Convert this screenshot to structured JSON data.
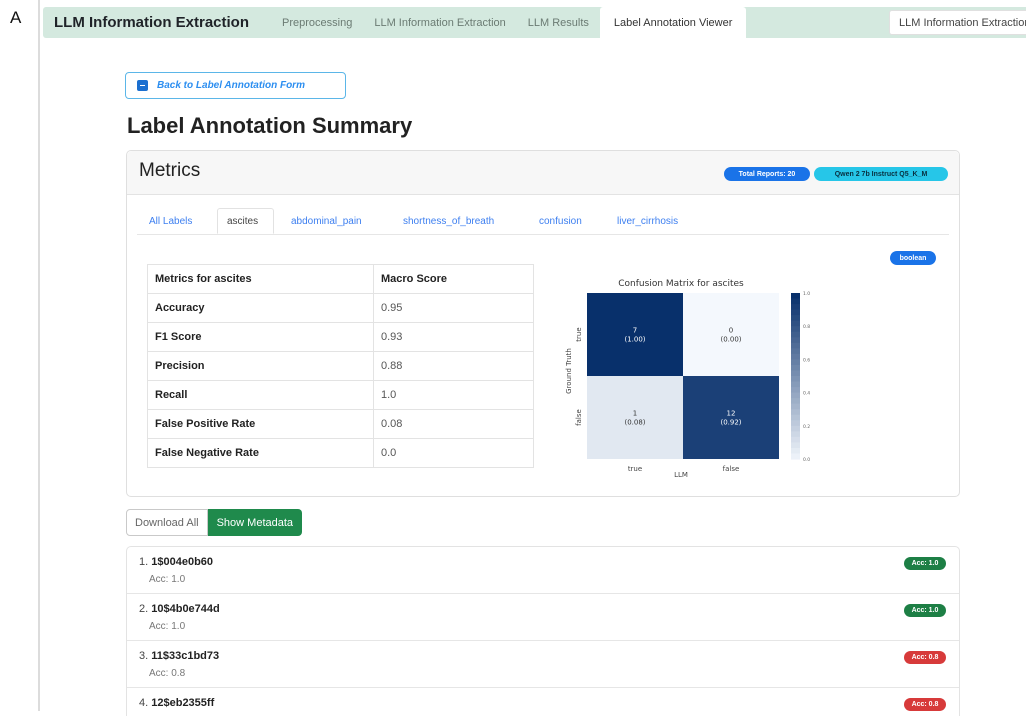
{
  "figure_label": "A",
  "navbar": {
    "brand": "LLM Information Extraction",
    "tabs": [
      {
        "label": "Preprocessing"
      },
      {
        "label": "LLM Information Extraction"
      },
      {
        "label": "LLM Results"
      },
      {
        "label": "Label Annotation Viewer"
      }
    ],
    "active_tab": "Label Annotation Viewer",
    "select": {
      "value": "LLM Information Extraction"
    }
  },
  "back_button": {
    "label": "Back to Label Annotation Form"
  },
  "page_title": "Label Annotation Summary",
  "metrics_card": {
    "title": "Metrics",
    "badges": {
      "total": "Total Reports: 20",
      "model": "Qwen 2 7b Instruct Q5_K_M"
    },
    "tabs": [
      {
        "label": "All Labels"
      },
      {
        "label": "ascites"
      },
      {
        "label": "abdominal_pain"
      },
      {
        "label": "shortness_of_breath"
      },
      {
        "label": "confusion"
      },
      {
        "label": "liver_cirrhosis"
      }
    ],
    "active_tab": "ascites",
    "type_badge": "boolean",
    "table": {
      "header": [
        "Metrics for ascites",
        "Macro Score"
      ],
      "rows": [
        {
          "metric": "Accuracy",
          "value": "0.95"
        },
        {
          "metric": "F1 Score",
          "value": "0.93"
        },
        {
          "metric": "Precision",
          "value": "0.88"
        },
        {
          "metric": "Recall",
          "value": "1.0"
        },
        {
          "metric": "False Positive Rate",
          "value": "0.08"
        },
        {
          "metric": "False Negative Rate",
          "value": "0.0"
        }
      ]
    }
  },
  "chart_data": {
    "type": "heatmap",
    "title": "Confusion Matrix for ascites",
    "xlabel": "LLM",
    "ylabel": "Ground Truth",
    "x_categories": [
      "true",
      "false"
    ],
    "y_categories": [
      "true",
      "false"
    ],
    "counts": [
      [
        7,
        0
      ],
      [
        1,
        12
      ]
    ],
    "cell_labels": [
      [
        "7\n(1.00)",
        "0\n(0.00)"
      ],
      [
        "1\n(0.08)",
        "12\n(0.92)"
      ]
    ],
    "normalized": [
      [
        1.0,
        0.0
      ],
      [
        0.08,
        0.92
      ]
    ],
    "colorbar_ticks": [
      "1.0",
      "0.8",
      "0.6",
      "0.4",
      "0.2",
      "0.0"
    ],
    "colorbar_range": [
      0,
      1
    ],
    "colors": {
      "low": "#f4f8fd",
      "high": "#08306b"
    }
  },
  "buttons": {
    "download_all": "Download All",
    "show_metadata": "Show Metadata"
  },
  "reports": [
    {
      "index": "1.",
      "id": "1$004e0b60",
      "acc": "Acc: 1.0",
      "badge": "Acc: 1.0",
      "status": "good"
    },
    {
      "index": "2.",
      "id": "10$4b0e744d",
      "acc": "Acc: 1.0",
      "badge": "Acc: 1.0",
      "status": "good"
    },
    {
      "index": "3.",
      "id": "11$33c1bd73",
      "acc": "Acc: 0.8",
      "badge": "Acc: 0.8",
      "status": "bad"
    },
    {
      "index": "4.",
      "id": "12$eb2355ff",
      "acc": "",
      "badge": "Acc: 0.8",
      "status": "bad"
    }
  ]
}
